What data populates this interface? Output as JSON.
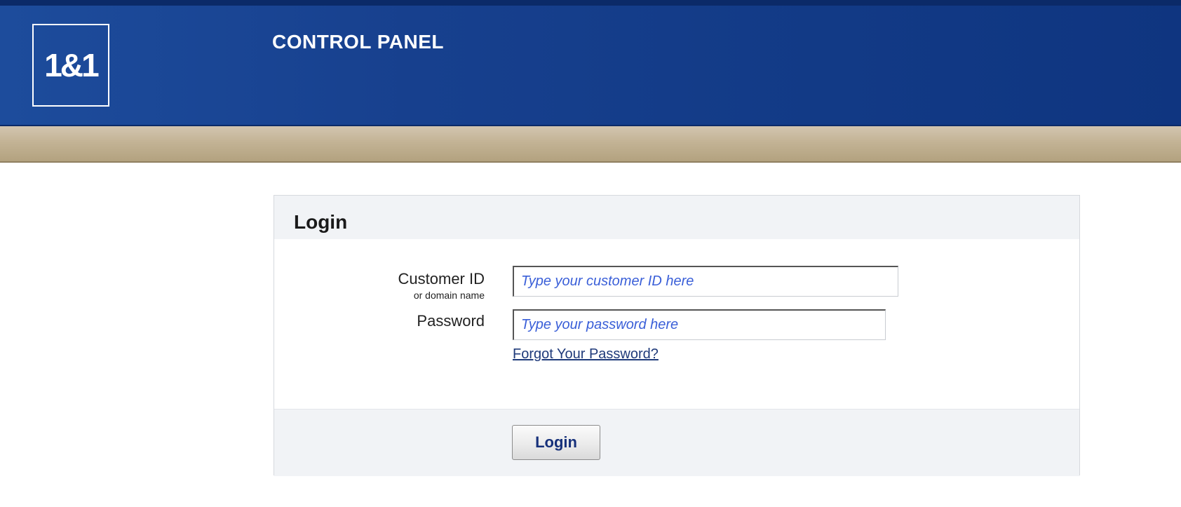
{
  "header": {
    "logo_text": "1&1",
    "app_title": "CONTROL PANEL"
  },
  "login": {
    "title": "Login",
    "customer_id_label": "Customer ID",
    "customer_id_sublabel": "or domain name",
    "customer_id_placeholder": "Type your customer ID here",
    "customer_id_value": "",
    "password_label": "Password",
    "password_placeholder": "Type your password here",
    "password_value": "",
    "forgot_password_link": "Forgot Your Password?",
    "submit_label": "Login"
  },
  "colors": {
    "header_blue": "#17408e",
    "nav_tan": "#c3b395",
    "placeholder_blue": "#3a5fd8",
    "link_blue": "#1f3a7a",
    "button_text": "#16307a"
  }
}
